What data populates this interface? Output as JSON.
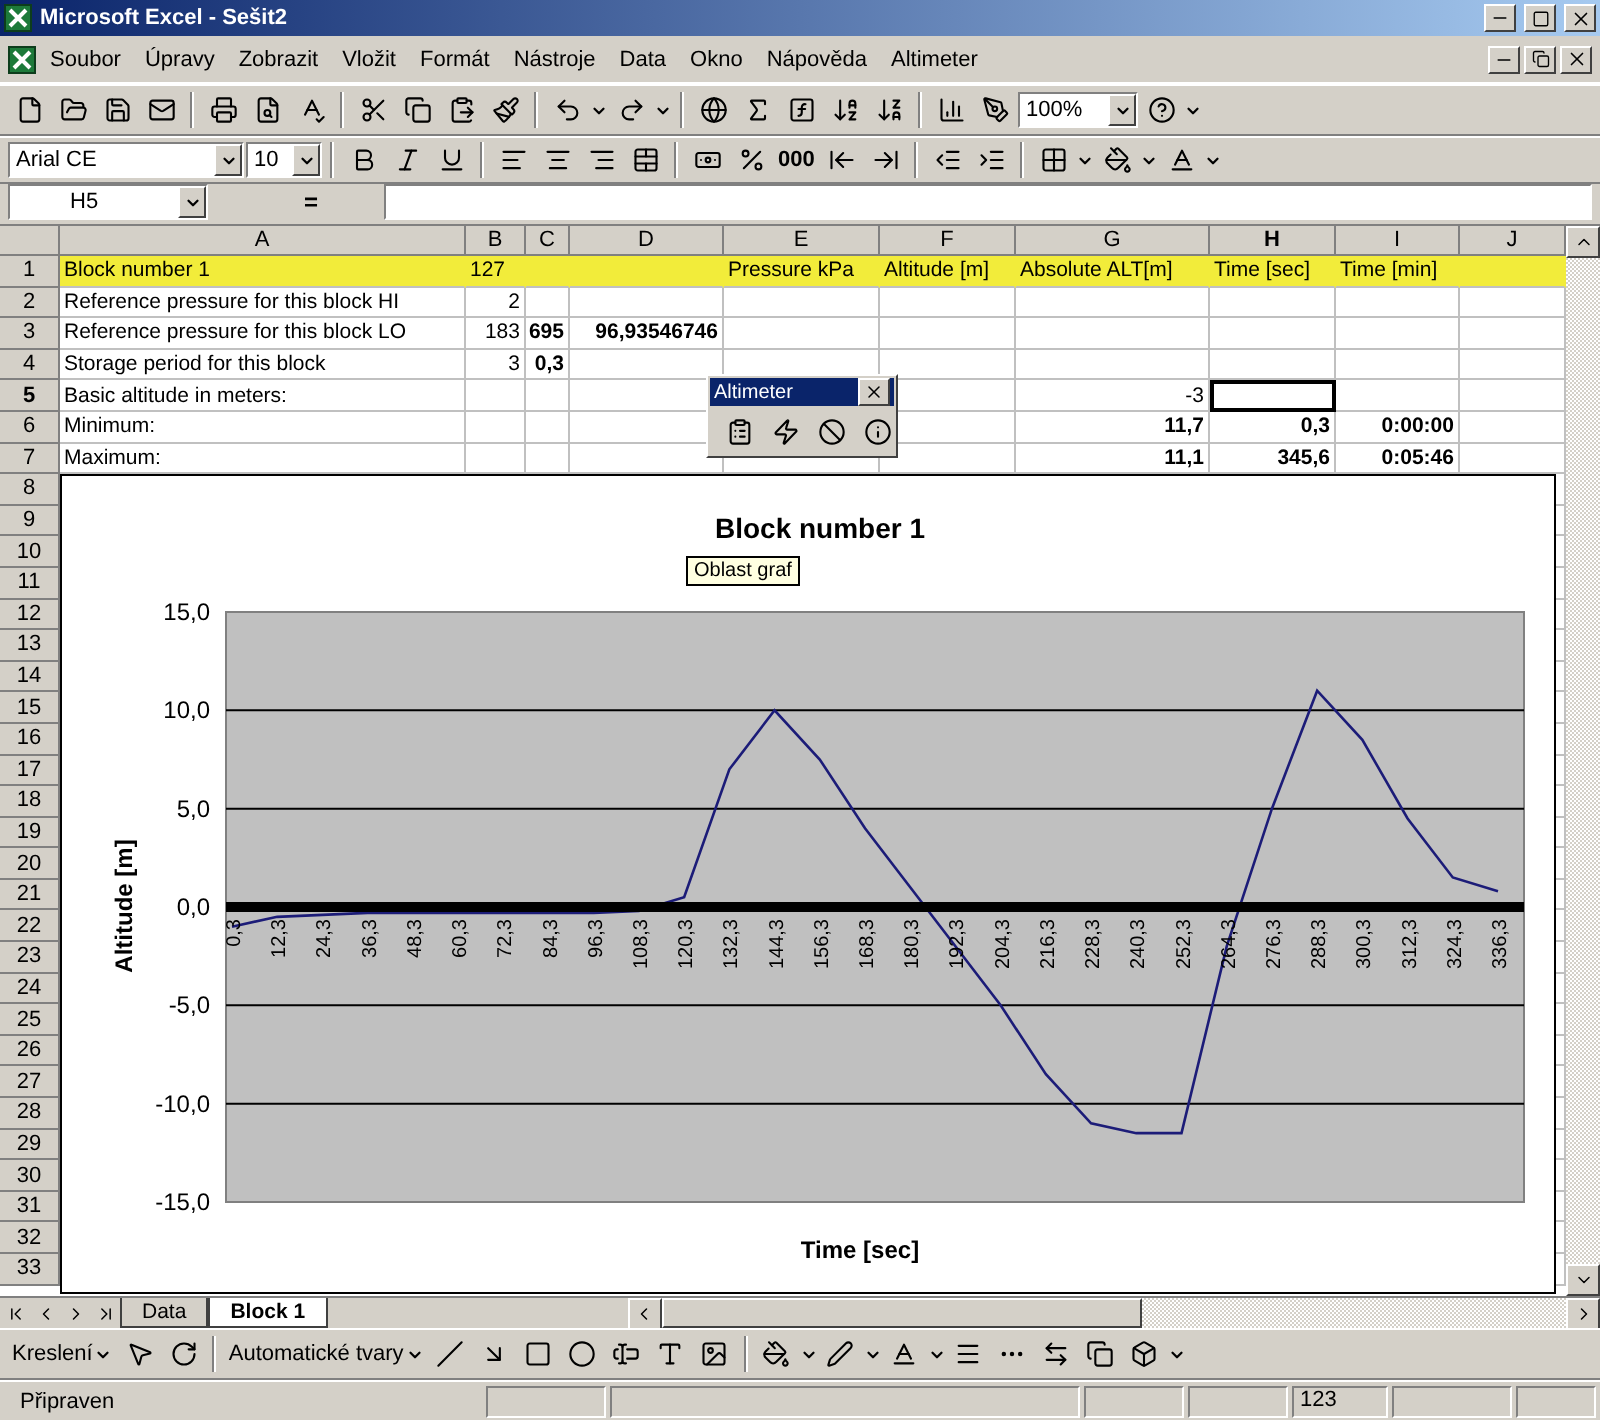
{
  "window": {
    "title": "Microsoft Excel - Sešit2"
  },
  "menu": [
    {
      "label": "Soubor"
    },
    {
      "label": "Úpravy"
    },
    {
      "label": "Zobrazit"
    },
    {
      "label": "Vložit"
    },
    {
      "label": "Formát"
    },
    {
      "label": "Nástroje"
    },
    {
      "label": "Data"
    },
    {
      "label": "Okno"
    },
    {
      "label": "Nápověda"
    },
    {
      "label": "Altimeter"
    }
  ],
  "standard_toolbar": {
    "zoom": "100%"
  },
  "format_toolbar": {
    "font": "Arial CE",
    "size": "10",
    "thousands": "000"
  },
  "formula_bar": {
    "name_box": "H5",
    "equals": "="
  },
  "columns": [
    {
      "label": "A",
      "selected": false
    },
    {
      "label": "B",
      "selected": false
    },
    {
      "label": "C",
      "selected": false
    },
    {
      "label": "D",
      "selected": false
    },
    {
      "label": "E",
      "selected": false
    },
    {
      "label": "F",
      "selected": false
    },
    {
      "label": "G",
      "selected": false
    },
    {
      "label": "H",
      "selected": true
    },
    {
      "label": "I",
      "selected": false
    },
    {
      "label": "J",
      "selected": false
    }
  ],
  "rows": [
    {
      "number": "1",
      "selected": false,
      "highlight": true,
      "cells": [
        {
          "text": "Block number 1",
          "kind": "text",
          "bold": false
        },
        {
          "text": "127",
          "kind": "text",
          "bold": false
        },
        {},
        {},
        {
          "text": "Pressure kPa",
          "kind": "text",
          "bold": false
        },
        {
          "text": "Altitude [m]",
          "kind": "text",
          "bold": false
        },
        {
          "text": "Absolute ALT[m]",
          "kind": "text",
          "bold": false
        },
        {
          "text": "Time [sec]",
          "kind": "text",
          "bold": false
        },
        {
          "text": "Time [min]",
          "kind": "text",
          "bold": false
        }
      ]
    },
    {
      "number": "2",
      "selected": false,
      "highlight": false,
      "cells": [
        {
          "text": "Reference pressure for this block HI",
          "kind": "text",
          "bold": false
        },
        {
          "text": "2",
          "kind": "number",
          "bold": false
        }
      ]
    },
    {
      "number": "3",
      "selected": false,
      "highlight": false,
      "cells": [
        {
          "text": "Reference pressure for this block LO",
          "kind": "text",
          "bold": false
        },
        {
          "text": "183",
          "kind": "number",
          "bold": false
        },
        {
          "text": "695",
          "kind": "number",
          "bold": true
        },
        {
          "text": "96,93546746",
          "kind": "number",
          "bold": true
        }
      ]
    },
    {
      "number": "4",
      "selected": false,
      "highlight": false,
      "cells": [
        {
          "text": "Storage period for this block",
          "kind": "text",
          "bold": false
        },
        {
          "text": "3",
          "kind": "number",
          "bold": false
        },
        {
          "text": "0,3",
          "kind": "number",
          "bold": true
        }
      ]
    },
    {
      "number": "5",
      "selected": true,
      "highlight": false,
      "cells": [
        {
          "text": "Basic altitude in meters:",
          "kind": "text",
          "bold": false
        },
        {},
        {},
        {},
        {},
        {},
        {
          "text": "-3",
          "kind": "number",
          "bold": false
        },
        {
          "active": true
        }
      ]
    },
    {
      "number": "6",
      "selected": false,
      "highlight": false,
      "cells": [
        {
          "text": "Minimum:",
          "kind": "text",
          "bold": false
        },
        {},
        {},
        {},
        {},
        {},
        {
          "text": "11,7",
          "kind": "number",
          "bold": true
        },
        {
          "text": "0,3",
          "kind": "number",
          "bold": true
        },
        {
          "text": "0:00:00",
          "kind": "number",
          "bold": true
        }
      ]
    },
    {
      "number": "7",
      "selected": false,
      "highlight": false,
      "cells": [
        {
          "text": "Maximum:",
          "kind": "text",
          "bold": false
        },
        {},
        {},
        {},
        {},
        {},
        {
          "text": "11,1",
          "kind": "number",
          "bold": true
        },
        {
          "text": "345,6",
          "kind": "number",
          "bold": true
        },
        {
          "text": "0:05:46",
          "kind": "number",
          "bold": true
        }
      ]
    },
    {
      "number": "8",
      "selected": false,
      "highlight": false
    },
    {
      "number": "9",
      "selected": false,
      "highlight": false
    },
    {
      "number": "10",
      "selected": false,
      "highlight": false
    },
    {
      "number": "11",
      "selected": false,
      "highlight": false
    },
    {
      "number": "12",
      "selected": false,
      "highlight": false
    },
    {
      "number": "13",
      "selected": false,
      "highlight": false
    },
    {
      "number": "14",
      "selected": false,
      "highlight": false
    },
    {
      "number": "15",
      "selected": false,
      "highlight": false
    },
    {
      "number": "16",
      "selected": false,
      "highlight": false
    },
    {
      "number": "17",
      "selected": false,
      "highlight": false
    },
    {
      "number": "18",
      "selected": false,
      "highlight": false
    },
    {
      "number": "19",
      "selected": false,
      "highlight": false
    },
    {
      "number": "20",
      "selected": false,
      "highlight": false
    },
    {
      "number": "21",
      "selected": false,
      "highlight": false
    },
    {
      "number": "22",
      "selected": false,
      "highlight": false
    },
    {
      "number": "23",
      "selected": false,
      "highlight": false
    },
    {
      "number": "24",
      "selected": false,
      "highlight": false
    },
    {
      "number": "25",
      "selected": false,
      "highlight": false
    },
    {
      "number": "26",
      "selected": false,
      "highlight": false
    },
    {
      "number": "27",
      "selected": false,
      "highlight": false
    },
    {
      "number": "28",
      "selected": false,
      "highlight": false
    },
    {
      "number": "29",
      "selected": false,
      "highlight": false
    },
    {
      "number": "30",
      "selected": false,
      "highlight": false
    },
    {
      "number": "31",
      "selected": false,
      "highlight": false
    },
    {
      "number": "32",
      "selected": false,
      "highlight": false
    },
    {
      "number": "33",
      "selected": false,
      "highlight": false
    }
  ],
  "altimeter_toolbar": {
    "title": "Altimeter"
  },
  "chart": {
    "tooltip": "Oblast graf",
    "chart_data": {
      "type": "line",
      "title": "Block number 1",
      "xlabel": "Time [sec]",
      "ylabel": "Altitude [m]",
      "categories": [
        "0,3",
        "12,3",
        "24,3",
        "36,3",
        "48,3",
        "60,3",
        "72,3",
        "84,3",
        "96,3",
        "108,3",
        "120,3",
        "132,3",
        "144,3",
        "156,3",
        "168,3",
        "180,3",
        "192,3",
        "204,3",
        "216,3",
        "228,3",
        "240,3",
        "252,3",
        "264,3",
        "276,3",
        "288,3",
        "300,3",
        "312,3",
        "324,3",
        "336,3"
      ],
      "series": [
        {
          "color": "#1c1c78",
          "values": [
            -1,
            -0.5,
            -0.4,
            -0.3,
            -0.3,
            -0.3,
            -0.3,
            -0.3,
            -0.3,
            -0.2,
            0.5,
            7,
            10,
            7.5,
            4,
            1,
            -2,
            -5,
            -8.5,
            -11,
            -11.5,
            -11.5,
            -2,
            5,
            11,
            8.5,
            4.5,
            1.5,
            0.8
          ]
        }
      ],
      "ylim": [
        -15,
        15
      ],
      "grid": true,
      "yticks": [
        {
          "value": 15,
          "label": "15,0"
        },
        {
          "value": 10,
          "label": "10,0"
        },
        {
          "value": 5,
          "label": "5,0"
        },
        {
          "value": 0,
          "label": "0,0"
        },
        {
          "value": -5,
          "label": "-5,0"
        },
        {
          "value": -10,
          "label": "-10,0"
        },
        {
          "value": -15,
          "label": "-15,0"
        }
      ]
    }
  },
  "sheet_tabs": [
    {
      "label": "Data",
      "selected": false
    },
    {
      "label": "Block 1",
      "selected": true
    }
  ],
  "drawing_toolbar": {
    "draw_menu": "Kreslení",
    "autoshapes": "Automatické tvary"
  },
  "status_bar": {
    "message": "Připraven",
    "indicator": "123"
  }
}
